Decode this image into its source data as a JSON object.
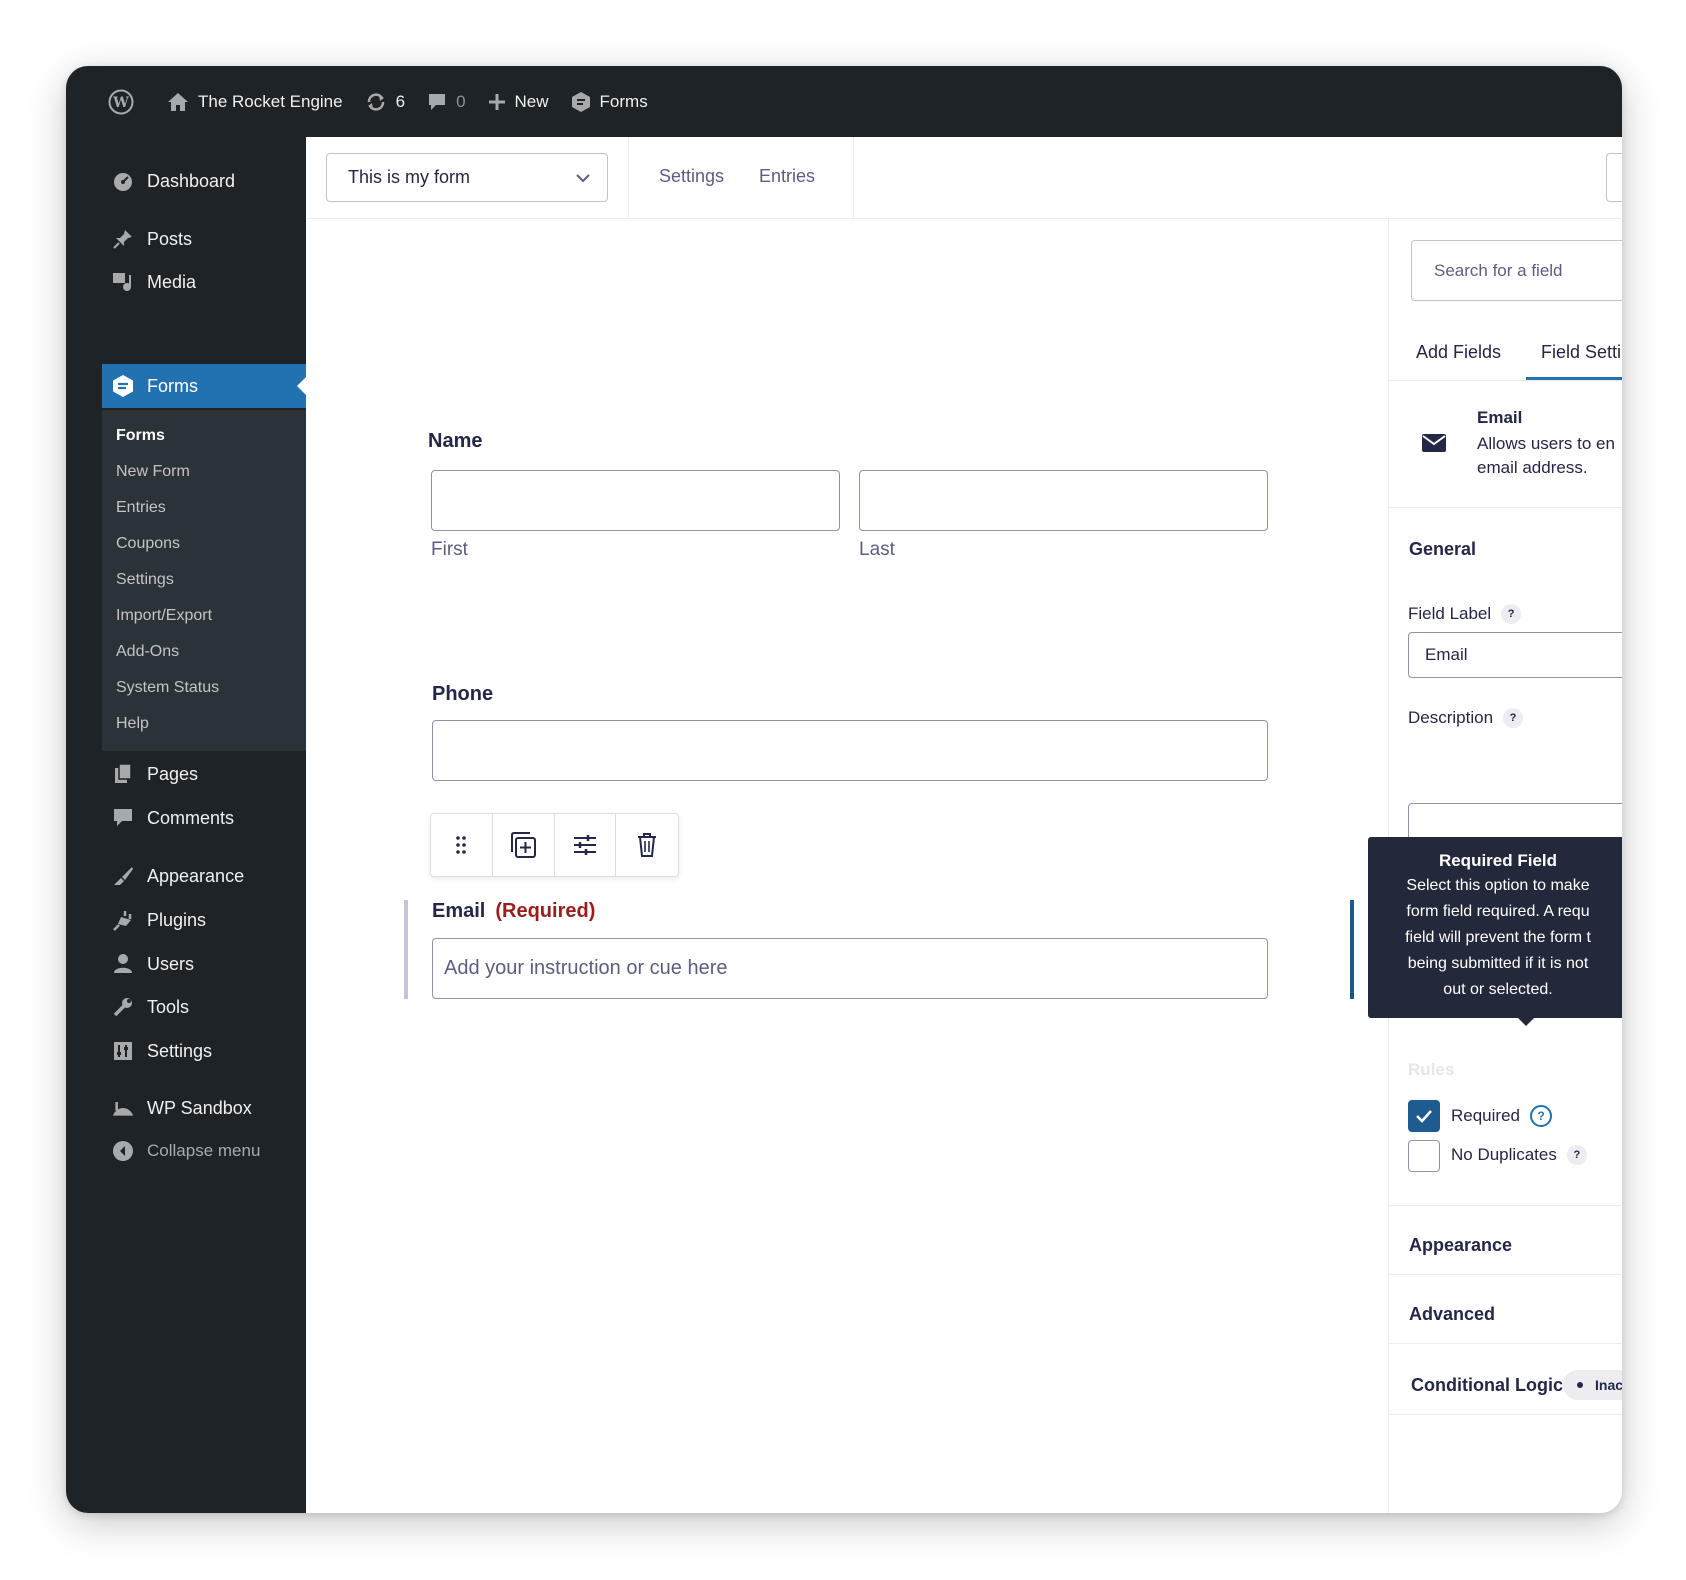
{
  "adminbar": {
    "site_name": "The Rocket Engine",
    "updates_count": "6",
    "comments_count": "0",
    "new_label": "New",
    "forms_label": "Forms"
  },
  "sidebar": {
    "items": [
      {
        "label": "Dashboard",
        "icon": "dashboard-icon"
      },
      {
        "label": "Posts",
        "icon": "pin-icon"
      },
      {
        "label": "Media",
        "icon": "media-icon"
      },
      {
        "label": "Forms",
        "icon": "forms-icon"
      },
      {
        "label": "Pages",
        "icon": "pages-icon"
      },
      {
        "label": "Comments",
        "icon": "comment-icon"
      },
      {
        "label": "Appearance",
        "icon": "brush-icon"
      },
      {
        "label": "Plugins",
        "icon": "plugin-icon"
      },
      {
        "label": "Users",
        "icon": "user-icon"
      },
      {
        "label": "Tools",
        "icon": "wrench-icon"
      },
      {
        "label": "Settings",
        "icon": "settings-icon"
      },
      {
        "label": "WP Sandbox",
        "icon": "sandbox-icon"
      },
      {
        "label": "Collapse menu",
        "icon": "collapse-icon"
      }
    ],
    "submenu": [
      "Forms",
      "New Form",
      "Entries",
      "Coupons",
      "Settings",
      "Import/Export",
      "Add-Ons",
      "System Status",
      "Help"
    ]
  },
  "toolbar": {
    "form_name": "This is my form",
    "settings_label": "Settings",
    "entries_label": "Entries"
  },
  "form": {
    "name_label": "Name",
    "first_label": "First",
    "last_label": "Last",
    "phone_label": "Phone",
    "email_label": "Email",
    "required_label": "(Required)",
    "email_placeholder": "Add your instruction or cue here"
  },
  "panel": {
    "search_placeholder": "Search for a field",
    "tab_add_fields": "Add Fields",
    "tab_field_settings": "Field Setti",
    "field_name": "Email",
    "field_desc_line1": "Allows users to en",
    "field_desc_line2": "email address.",
    "general_label": "General",
    "field_label_label": "Field Label",
    "field_label_value": "Email",
    "description_label": "Description",
    "rules_label": "Rules",
    "required_checkbox_label": "Required",
    "no_duplicates_label": "No Duplicates",
    "appearance_label": "Appearance",
    "advanced_label": "Advanced",
    "conditional_logic_label": "Conditional Logic",
    "conditional_badge": "Inac",
    "help_glyph": "?"
  },
  "tooltip": {
    "title": "Required Field",
    "body": "Select this option to make\nform field required. A requ\nfield will prevent the form t\nbeing submitted if it is not \nout or selected."
  },
  "colors": {
    "admin_bg": "#1d2327",
    "accent_blue": "#2271b1",
    "required_red": "#9b1c1c",
    "text_dark": "#242748"
  }
}
